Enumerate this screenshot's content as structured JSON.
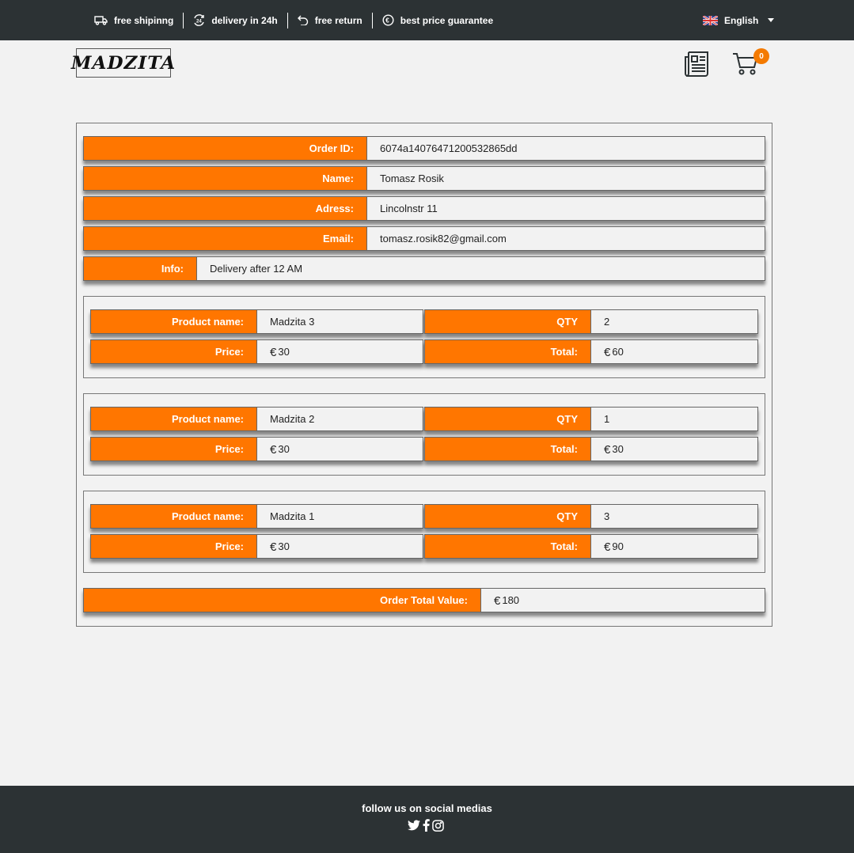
{
  "topbar": {
    "features": [
      {
        "icon": "truck-icon",
        "label": "free shipinng"
      },
      {
        "icon": "delivery-24h-icon",
        "label": "delivery in 24h"
      },
      {
        "icon": "return-arrow-icon",
        "label": "free return"
      },
      {
        "icon": "euro-circle-icon",
        "label": "best price guarantee"
      }
    ],
    "language": "English"
  },
  "header": {
    "logo": "MADZITA",
    "cart_count": "0"
  },
  "order": {
    "fields": [
      {
        "label": "Order ID:",
        "value": "6074a14076471200532865dd"
      },
      {
        "label": "Name:",
        "value": "Tomasz Rosik"
      },
      {
        "label": "Adress:",
        "value": "Lincolnstr 11"
      },
      {
        "label": "Email:",
        "value": "tomasz.rosik82@gmail.com"
      },
      {
        "label": "Info:",
        "value": "Delivery after 12 AM"
      }
    ],
    "product_labels": {
      "name": "Product name:",
      "qty": "QTY",
      "price": "Price:",
      "total": "Total:"
    },
    "currency": "€",
    "products": [
      {
        "name": "Madzita 3",
        "qty": "2",
        "price": "30",
        "total": "60"
      },
      {
        "name": "Madzita 2",
        "qty": "1",
        "price": "30",
        "total": "30"
      },
      {
        "name": "Madzita 1",
        "qty": "3",
        "price": "30",
        "total": "90"
      }
    ],
    "total_label": "Order Total Value:",
    "total_value": "180"
  },
  "footer": {
    "text": "follow us on social medias",
    "socials": [
      "twitter-icon",
      "facebook-icon",
      "instagram-icon"
    ]
  },
  "colors": {
    "accent": "#ff7600",
    "dark": "#2c3234",
    "background": "#f2f2f2"
  }
}
